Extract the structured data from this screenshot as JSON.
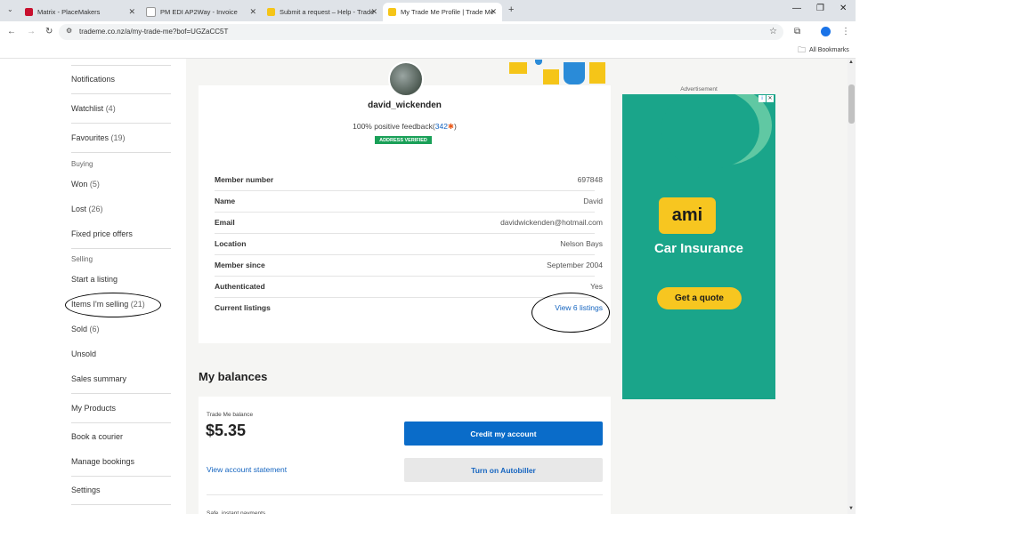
{
  "browser": {
    "tabs": [
      {
        "title": "Matrix - PlaceMakers"
      },
      {
        "title": "PM EDI AP2Way - Invoice"
      },
      {
        "title": "Submit a request – Help - Trade"
      },
      {
        "title": "My Trade Me Profile | Trade Me"
      }
    ],
    "url": "trademe.co.nz/a/my-trade-me?bof=UGZaCC5T",
    "bookmarks_label": "All Bookmarks"
  },
  "sidebar": {
    "items_top": [
      {
        "label": "Notifications",
        "count": ""
      },
      {
        "label": "Watchlist",
        "count": "(4)"
      },
      {
        "label": "Favourites",
        "count": "(19)"
      }
    ],
    "buying_heading": "Buying",
    "buying": [
      {
        "label": "Won",
        "count": "(5)"
      },
      {
        "label": "Lost",
        "count": "(26)"
      },
      {
        "label": "Fixed price offers",
        "count": ""
      }
    ],
    "selling_heading": "Selling",
    "selling": [
      {
        "label": "Start a listing",
        "count": ""
      },
      {
        "label": "Items I'm selling",
        "count": "(21)"
      },
      {
        "label": "Sold",
        "count": "(6)"
      },
      {
        "label": "Unsold",
        "count": ""
      },
      {
        "label": "Sales summary",
        "count": ""
      }
    ],
    "other": [
      {
        "label": "My Products"
      },
      {
        "label": "Book a courier"
      },
      {
        "label": "Manage bookings"
      },
      {
        "label": "Settings"
      }
    ]
  },
  "profile": {
    "username": "david_wickenden",
    "feedback_text": "100% positive feedback",
    "feedback_count": "342",
    "badge": "ADDRESS VERIFIED",
    "rows": [
      {
        "label": "Member number",
        "value": "697848"
      },
      {
        "label": "Name",
        "value": "David"
      },
      {
        "label": "Email",
        "value": "davidwickenden@hotmail.com"
      },
      {
        "label": "Location",
        "value": "Nelson Bays"
      },
      {
        "label": "Member since",
        "value": "September 2004"
      },
      {
        "label": "Authenticated",
        "value": "Yes"
      },
      {
        "label": "Current listings",
        "value": "View 6 listings"
      }
    ]
  },
  "balances": {
    "heading": "My balances",
    "balance_label": "Trade Me balance",
    "balance_value": "$5.35",
    "credit_button": "Credit my account",
    "statement_link": "View account statement",
    "autobiller_button": "Turn on Autobiller",
    "cutoff_text": "Safe, instant payments"
  },
  "ad": {
    "label": "Advertisement",
    "brand": "ami",
    "headline": "Car Insurance",
    "cta": "Get a quote"
  },
  "colors": {
    "link": "#1565c0",
    "primary_button": "#0a6cc9",
    "ad_bg": "#1aa58a",
    "ami_yellow": "#f7c620",
    "verified_green": "#1aa058"
  }
}
